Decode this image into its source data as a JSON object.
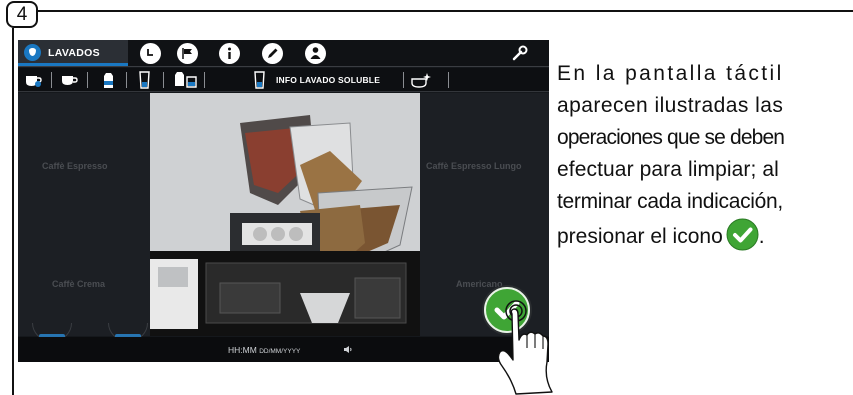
{
  "step": {
    "number": "4"
  },
  "screen": {
    "topbar": {
      "active_tab": "LAVADOS",
      "icons": [
        "clock-icon",
        "flag-icon",
        "info-icon",
        "pencil-icon",
        "person-icon",
        "wrench-icon"
      ]
    },
    "subbar": {
      "info_label": "INFO LAVADO SOLUBLE",
      "icons": [
        "cup-refresh-icon",
        "cup-icon",
        "milk-carton-icon",
        "glass-icon",
        "milk-pour-icon",
        "glass-icon",
        "cup-sparkle-icon"
      ]
    },
    "background_menu": {
      "left": [
        "Caffè Espresso",
        "Caffè Crema"
      ],
      "right": [
        "Caffè Espresso Lungo",
        "Americano"
      ]
    },
    "status": {
      "time": "HH:MM",
      "date": "DD/MM/YYYY"
    },
    "confirm_icon": "checkmark-icon"
  },
  "instruction": {
    "line1": "En la pantalla táctil",
    "line2": "aparecen ilustradas las",
    "line3": "operaciones que se deben",
    "line4": "efectuar para limpiar; al",
    "line5": "terminar cada indicación,",
    "line6_before": "presionar el icono",
    "line6_after": "."
  },
  "colors": {
    "confirm_green": "#3fa535",
    "accent_blue": "#1a78c2",
    "screen_dark": "#15181c"
  }
}
